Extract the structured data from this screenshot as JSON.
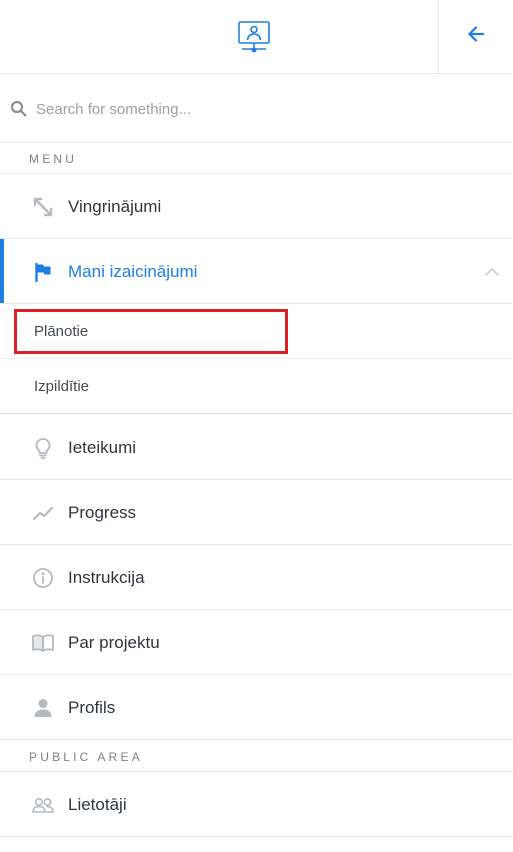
{
  "header": {
    "logo_icon": "presenter-monitor-icon",
    "back_icon": "arrow-left-icon"
  },
  "search": {
    "placeholder": "Search for something..."
  },
  "sections": {
    "menu_label": "MENU",
    "public_label": "PUBLIC AREA"
  },
  "menu": {
    "items": [
      {
        "label": "Vingrinājumi",
        "icon": "arrows-diagonal-icon"
      },
      {
        "label": "Mani izaicinājumi",
        "icon": "flag-icon",
        "active": true,
        "expanded": true
      },
      {
        "label": "Ieteikumi",
        "icon": "lightbulb-icon"
      },
      {
        "label": "Progress",
        "icon": "trending-line-icon"
      },
      {
        "label": "Instrukcija",
        "icon": "info-circle-icon"
      },
      {
        "label": "Par projektu",
        "icon": "open-book-icon"
      },
      {
        "label": "Profils",
        "icon": "user-icon"
      }
    ],
    "submenu": [
      {
        "label": "Plānotie",
        "highlighted": true
      },
      {
        "label": "Izpildītie"
      }
    ]
  },
  "public": {
    "items": [
      {
        "label": "Lietotāji",
        "icon": "users-icon"
      }
    ]
  },
  "colors": {
    "accent": "#1d7fe0",
    "highlight": "#dc2025",
    "icon_gray": "#b4bac0",
    "divider": "#e6e8ea"
  }
}
